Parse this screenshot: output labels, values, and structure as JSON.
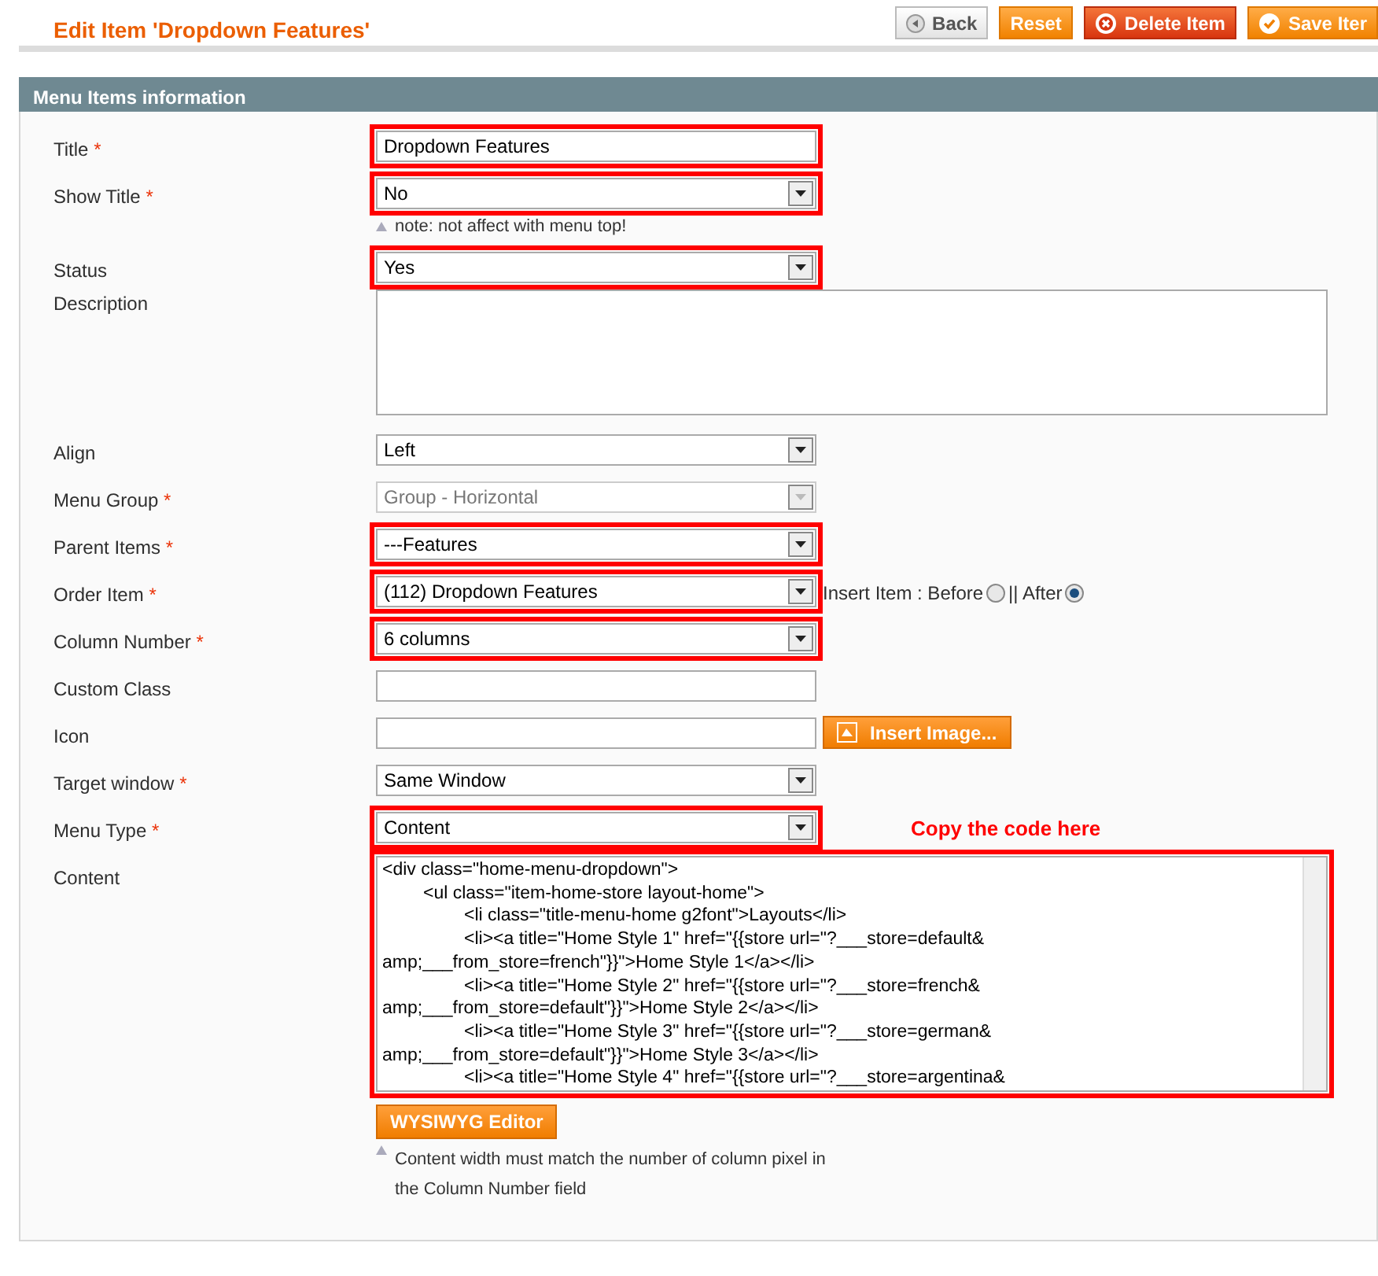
{
  "header": {
    "title": "Edit Item 'Dropdown Features'",
    "buttons": [
      {
        "label": "Back",
        "kind": "back"
      },
      {
        "label": "Reset",
        "kind": "plain"
      },
      {
        "label": "Delete Item",
        "kind": "delete"
      },
      {
        "label": "Save Iter",
        "kind": "save"
      }
    ]
  },
  "section": {
    "title": "Menu Items information"
  },
  "fields": [
    {
      "kind": "text",
      "label": "Title",
      "required_mark": "*",
      "value": "Dropdown Features",
      "highlighted": true
    },
    {
      "kind": "select",
      "label": "Show Title",
      "required_mark": "*",
      "value": "No",
      "highlighted": true,
      "note": "note: not affect with menu top!"
    },
    {
      "kind": "select",
      "label": "Status",
      "value": "Yes",
      "highlighted": true
    },
    {
      "kind": "textarea",
      "label": "Description",
      "highlighted": false
    },
    {
      "kind": "select",
      "label": "Align",
      "value": "Left",
      "highlighted": false
    },
    {
      "kind": "select",
      "label": "Menu Group",
      "required_mark": "*",
      "value": "Group - Horizontal",
      "highlighted": false,
      "disabled": true
    },
    {
      "kind": "select",
      "label": "Parent Items",
      "required_mark": "*",
      "value": "---Features",
      "highlighted": true
    },
    {
      "kind": "select",
      "label": "Order Item",
      "required_mark": "*",
      "value": "(112) Dropdown Features",
      "highlighted": true,
      "insert": {
        "options": [
          {
            "label": "Insert Item : Before",
            "selected": false
          },
          {
            "label": "|| After",
            "selected": true
          }
        ]
      }
    },
    {
      "kind": "select",
      "label": "Column Number",
      "required_mark": "*",
      "value": "6 columns",
      "highlighted": true
    },
    {
      "kind": "text",
      "label": "Custom Class",
      "highlighted": false
    },
    {
      "kind": "text",
      "label": "Icon",
      "highlighted": false,
      "button": "Insert Image..."
    },
    {
      "kind": "select",
      "label": "Target window",
      "required_mark": "*",
      "value": "Same Window",
      "highlighted": false
    },
    {
      "kind": "select",
      "label": "Menu Type",
      "required_mark": "*",
      "value": "Content",
      "highlighted": true,
      "annotation": "Copy the code here"
    },
    {
      "kind": "code",
      "label": "Content",
      "highlighted": true,
      "button": "WYSIWYG Editor",
      "note": "Content width must match the number of column pixel in the Column Number field",
      "lines": [
        "<div class=\"home-menu-dropdown\">",
        "\t<ul class=\"item-home-store layout-home\">",
        "\t\t<li class=\"title-menu-home g2font\">Layouts</li>",
        "\t\t<li><a title=\"Home Style 1\" href=\"{{store url=\"?___store=default&",
        "amp;___from_store=french\"}}\">Home Style 1</a></li>",
        "\t\t<li><a title=\"Home Style 2\" href=\"{{store url=\"?___store=french&",
        "amp;___from_store=default\"}}\">Home Style 2</a></li>",
        "\t\t<li><a title=\"Home Style 3\" href=\"{{store url=\"?___store=german&",
        "amp;___from_store=default\"}}\">Home Style 3</a></li>",
        "\t\t<li><a title=\"Home Style 4\" href=\"{{store url=\"?___store=argentina&"
      ]
    }
  ]
}
